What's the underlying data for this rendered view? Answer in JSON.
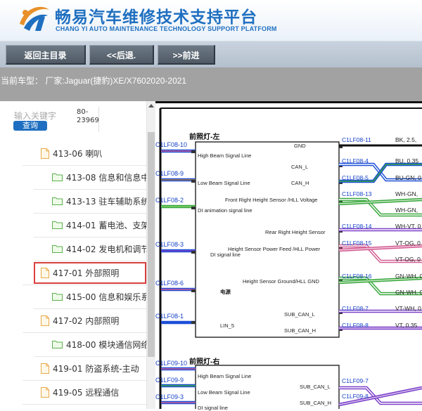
{
  "header": {
    "title_cn": "畅易汽车维修技术支持平台",
    "title_en": "CHANG YI AUTO MAINTENANCE TECHNOLOGY SUPPORT PLATFORM"
  },
  "toolbar": {
    "home_label": "返回主目录",
    "back_label": "<<后退.",
    "forward_label": ">>前进"
  },
  "vehicle_bar": {
    "label": "当前车型：  厂家:Jaguar(捷豹)XE/X7602020-2021"
  },
  "search": {
    "placeholder": "输入关键字",
    "query_label": "查询",
    "code_line1": "80-",
    "code_line2": "23969"
  },
  "tree": [
    {
      "icon": "file-icon",
      "label": "413-06 喇叭"
    },
    {
      "icon": "folder-icon",
      "label": "413-08 信息和信息中"
    },
    {
      "icon": "folder-icon",
      "label": "413-13 驻车辅助系统"
    },
    {
      "icon": "folder-icon",
      "label": "414-01 蓄电池、支架"
    },
    {
      "icon": "folder-icon",
      "label": "414-02 发电机和调节"
    },
    {
      "icon": "file-icon",
      "label": "417-01 外部照明",
      "selected": true
    },
    {
      "icon": "folder-icon",
      "label": "415-00 信息和娱乐系"
    },
    {
      "icon": "file-icon",
      "label": "417-02 内部照明"
    },
    {
      "icon": "folder-icon",
      "label": "418-00 模块通信网络"
    },
    {
      "icon": "file-icon",
      "label": "419-01 防盗系统-主动"
    },
    {
      "icon": "file-icon",
      "label": "419-05 远程通信"
    }
  ],
  "diagram": {
    "headlamp_left": "前照灯-左",
    "headlamp_right": "前照灯-右",
    "left_connectors": [
      "C1LF08-10",
      "C1LF08-9",
      "C1LF08-2",
      "C1LF08-3",
      "C1LF08-6",
      "C1LF08-1"
    ],
    "left_connectors_right": [
      "C1LF09-10",
      "C1LF09-9",
      "C1LF09-3"
    ],
    "box_signals_left": [
      "GND",
      "High Beam Signal Line",
      "CAN_L",
      "Low Beam Signal Line",
      "CAN_H",
      "Front Right Height Sensor /HLL Voltage",
      "DI animation signal line",
      "Rear Right Height Sensor",
      "Height Sensor Power Feed /HLL Power",
      "DI signal line",
      "Height Sensor Ground/HLL GND",
      "电源",
      "SUB_CAN_L",
      "LIN_5",
      "SUB_CAN_H"
    ],
    "box_signals_right": [
      "High Beam Signal Line",
      "SUB_CAN_L",
      "Low Beam Signal Line",
      "SUB_CAN_H",
      "DI signal line"
    ],
    "right_connectors": [
      "C1LF08-11",
      "C1LF08-4",
      "C1LF08-5",
      "C1LF08-13",
      "C1LF08-14",
      "C1LF08-15",
      "C1LF08-16",
      "C1LF08-7",
      "C1LF08-8"
    ],
    "right_connectors_lower": [
      "C1LF09-7",
      "C1LF09-8"
    ],
    "wire_labels": [
      "BK, 2.5,",
      "BU, 0.35",
      "BU-GN, 0",
      "WH-GN,",
      "WH-GN,",
      "WH-VT, 0",
      "VT-OG, 0",
      "VT-OG, 0",
      "GN-WH, 0",
      "GN-WH, 0",
      "VT-WH, 0",
      "VT, 0.35"
    ],
    "colors": {
      "blue": "#1c4fd6",
      "green": "#39a83e",
      "pink": "#d35e93",
      "purple": "#7b3fc8",
      "connector_label": "#1440c6"
    }
  }
}
